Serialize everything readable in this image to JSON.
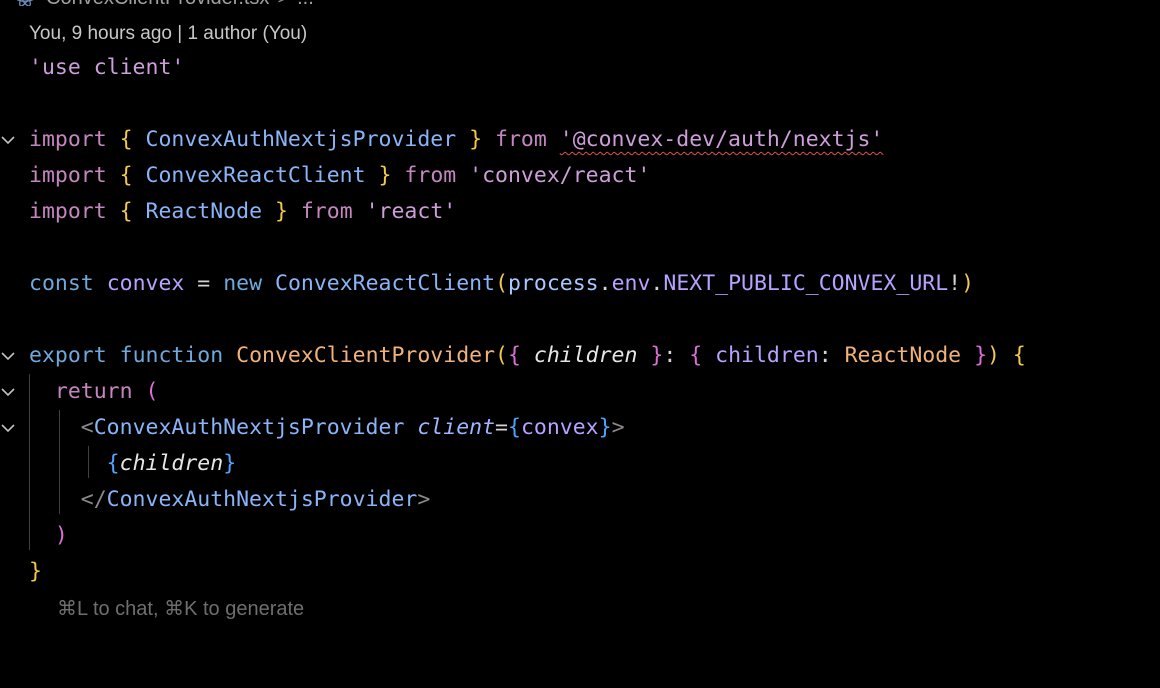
{
  "breadcrumb": {
    "file": "ConvexClientProvider.tsx",
    "separator": ">",
    "more": "..."
  },
  "blame": "You, 9 hours ago | 1 author (You)",
  "code": {
    "l1": {
      "t1": "'use client'"
    },
    "l3": {
      "t1": "import",
      "t2": " ",
      "t3": "{",
      "t4": " ConvexAuthNextjsProvider ",
      "t5": "}",
      "t6": " from ",
      "t7": "'@convex-dev/auth/nextjs'"
    },
    "l4": {
      "t1": "import",
      "t2": " ",
      "t3": "{",
      "t4": " ConvexReactClient ",
      "t5": "}",
      "t6": " from ",
      "t7": "'convex/react'"
    },
    "l5": {
      "t1": "import",
      "t2": " ",
      "t3": "{",
      "t4": " ReactNode ",
      "t5": "}",
      "t6": " from ",
      "t7": "'react'"
    },
    "l7": {
      "t1": "const",
      "t2": " ",
      "t3": "convex",
      "t4": " = ",
      "t5": "new",
      "t6": " ",
      "t7": "ConvexReactClient",
      "t8": "(",
      "t9": "process",
      "t10": ".",
      "t11": "env",
      "t12": ".",
      "t13": "NEXT_PUBLIC_CONVEX_URL",
      "t14": "!",
      "t15": ")"
    },
    "l9": {
      "t1": "export",
      "t2": " ",
      "t3": "function",
      "t4": " ",
      "t5": "ConvexClientProvider",
      "t6": "(",
      "t7": "{",
      "t8": " ",
      "t9": "children",
      "t10": " ",
      "t11": "}",
      "t12": ": ",
      "t13": "{",
      "t14": " ",
      "t15": "children",
      "t16": ": ",
      "t17": "ReactNode",
      "t18": " ",
      "t19": "}",
      "t20": ")",
      "t21": " ",
      "t22": "{"
    },
    "l10": {
      "t1": "  ",
      "t2": "return",
      "t3": " ",
      "t4": "("
    },
    "l11": {
      "t1": "    ",
      "t2": "<",
      "t3": "ConvexAuthNextjsProvider",
      "t4": " ",
      "t5": "client",
      "t6": "=",
      "t7": "{",
      "t8": "convex",
      "t9": "}",
      "t10": ">"
    },
    "l12": {
      "t1": "      ",
      "t2": "{",
      "t3": "children",
      "t4": "}"
    },
    "l13": {
      "t1": "    ",
      "t2": "</",
      "t3": "ConvexAuthNextjsProvider",
      "t4": ">"
    },
    "l14": {
      "t1": "  ",
      "t2": ")"
    },
    "l15": {
      "t1": "}"
    }
  },
  "hint": "⌘L to chat, ⌘K to generate",
  "colors": {
    "background": "#000000",
    "keyword": "#c586c0",
    "string": "#ce9edb",
    "class": "#8ab4f8",
    "brace": "#f2c94c",
    "function": "#f0b27a",
    "error_squiggle": "#e05252"
  }
}
